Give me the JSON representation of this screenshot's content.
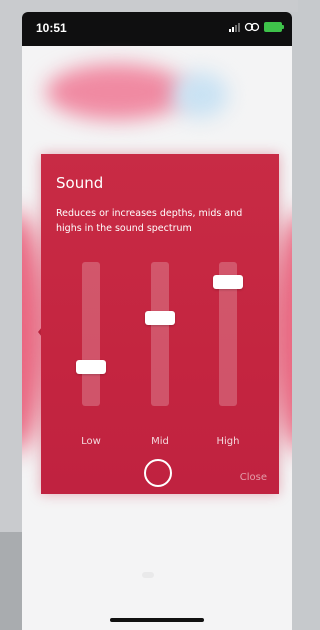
{
  "status_bar": {
    "time": "10:51",
    "icons": [
      "signal-icon",
      "link-icon",
      "battery-icon"
    ],
    "battery_color": "#3ec24a"
  },
  "modal": {
    "title": "Sound",
    "description": "Reduces or increases depths, mids and highs in the sound spectrum",
    "background_color": "#c42540",
    "sliders": [
      {
        "label": "Low",
        "level": 0.25
      },
      {
        "label": "Mid",
        "level": 0.62
      },
      {
        "label": "High",
        "level": 0.9
      }
    ],
    "reset_icon": "circle-icon",
    "close_label": "Close"
  },
  "colors": {
    "accent": "#c42540",
    "glow": "#e9657f",
    "background": "#f4f4f5"
  }
}
